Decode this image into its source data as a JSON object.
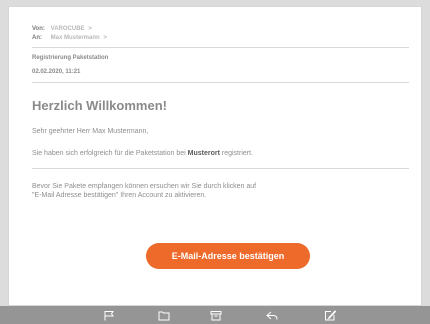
{
  "email": {
    "from_label": "Von:",
    "from_value": "VAROCUBE",
    "to_label": "An:",
    "to_value": "Max Mustermann",
    "chevron": ">",
    "subject": "Registrierung Paketstation",
    "date": "02.02.2020, 11:21",
    "greeting": "Herzlich Willkommen!",
    "salutation": "Sehr geehrter Herr Max Mustermann,",
    "registered_pre": "Sie haben sich erfolgreich für die Paketstation bei ",
    "registered_place": "Musterort",
    "registered_post": " registriert.",
    "confirm_line1": "Bevor Sie Pakete empfangen können ersuchen wir Sie durch klicken auf",
    "confirm_line2": "\"E-Mail Adresse bestätigen\" Ihren Account zu aktivieren.",
    "button_label": "E-Mail-Adresse bestätigen"
  },
  "toolbar": {
    "icons": [
      "flag-icon",
      "folder-icon",
      "archive-icon",
      "reply-icon",
      "compose-icon"
    ]
  },
  "colors": {
    "accent": "#ee6a2a",
    "toolbar": "#959595",
    "background": "#dcdcdc"
  }
}
